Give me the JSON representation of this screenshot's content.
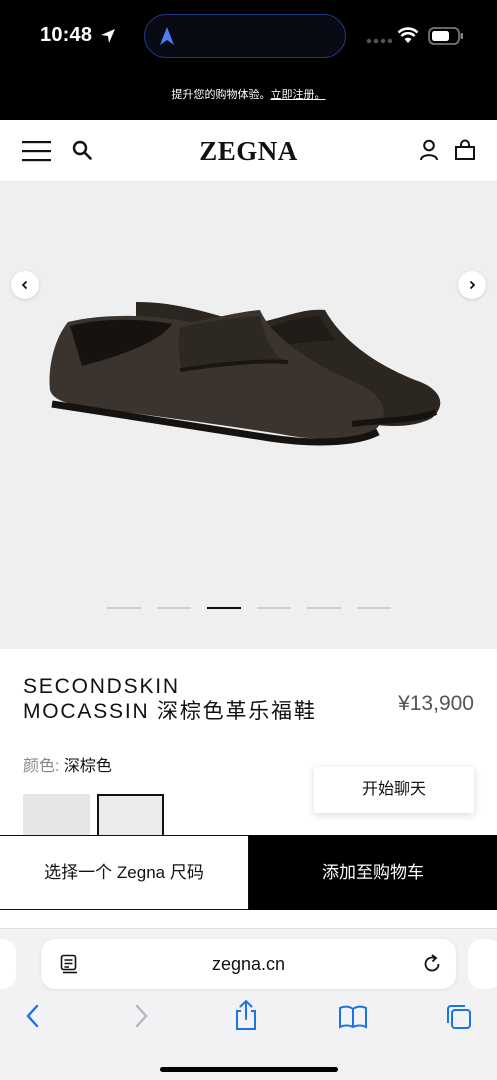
{
  "status_bar": {
    "time": "10:48"
  },
  "promo": {
    "text": "提升您的购物体验。",
    "link": "立即注册。"
  },
  "header": {
    "logo": "ZEGNA"
  },
  "gallery": {
    "slide_count": 6,
    "active_slide": 3
  },
  "product": {
    "title_line1": "SECONDSKIN",
    "title_line2": "MOCASSIN 深棕色革乐福鞋",
    "price": "¥13,900",
    "color_label": "颜色:",
    "color_value": "深棕色"
  },
  "chat": {
    "label": "开始聊天"
  },
  "actions": {
    "size_label": "选择一个 Zegna 尺码",
    "cart_label": "添加至购物车"
  },
  "browser": {
    "url": "zegna.cn"
  },
  "colors": {
    "accent": "#000000",
    "island_border": "#1f3a8a",
    "safari_blue": "#1a73e8"
  },
  "icons": [
    "location-arrow-icon",
    "wifi-icon",
    "battery-icon",
    "menu-icon",
    "search-icon",
    "account-icon",
    "shopping-bag-icon",
    "chevron-left-icon",
    "chevron-right-icon",
    "reader-icon",
    "reload-icon",
    "back-icon",
    "forward-icon",
    "share-icon",
    "bookmarks-icon",
    "tabs-icon"
  ]
}
